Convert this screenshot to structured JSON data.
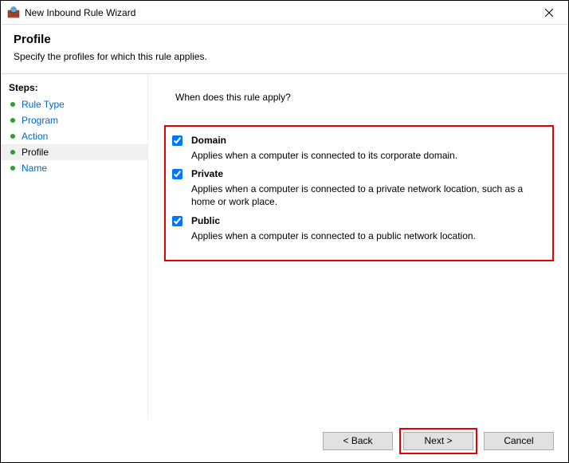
{
  "window": {
    "title": "New Inbound Rule Wizard"
  },
  "header": {
    "title": "Profile",
    "subtitle": "Specify the profiles for which this rule applies."
  },
  "sidebar": {
    "header": "Steps:",
    "items": [
      {
        "label": "Rule Type",
        "active": false
      },
      {
        "label": "Program",
        "active": false
      },
      {
        "label": "Action",
        "active": false
      },
      {
        "label": "Profile",
        "active": true
      },
      {
        "label": "Name",
        "active": false
      }
    ]
  },
  "content": {
    "question": "When does this rule apply?",
    "profiles": [
      {
        "label": "Domain",
        "checked": true,
        "description": "Applies when a computer is connected to its corporate domain."
      },
      {
        "label": "Private",
        "checked": true,
        "description": "Applies when a computer is connected to a private network location, such as a home or work place."
      },
      {
        "label": "Public",
        "checked": true,
        "description": "Applies when a computer is connected to a public network location."
      }
    ]
  },
  "footer": {
    "back": "< Back",
    "next": "Next >",
    "cancel": "Cancel"
  },
  "annotations": {
    "highlight_profiles_box": true,
    "highlight_next_button": true
  }
}
